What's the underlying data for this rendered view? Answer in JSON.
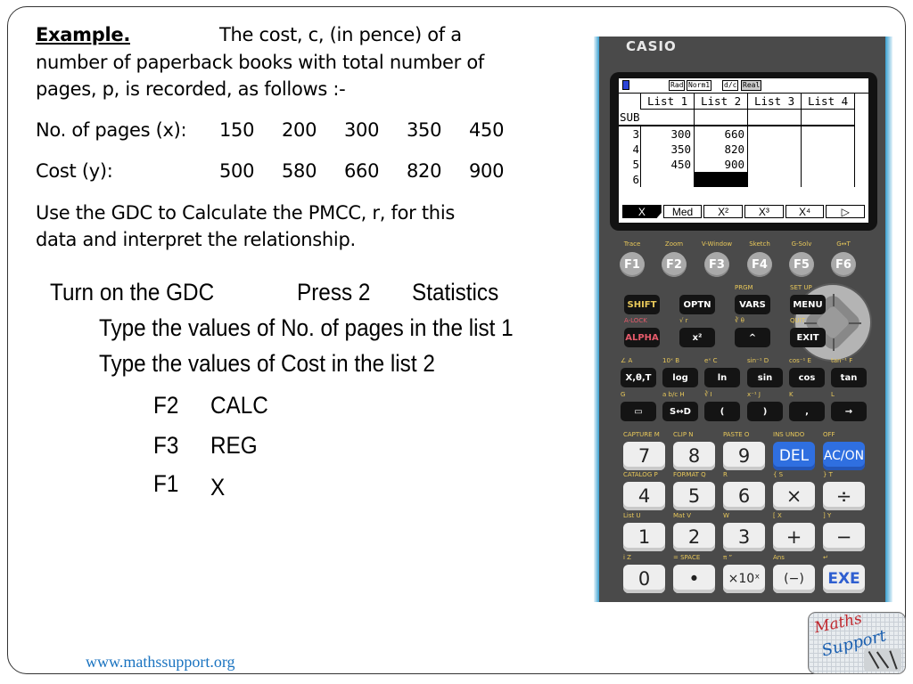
{
  "slide": {
    "title": "Example.",
    "intro_line1": "The cost, c, (in pence) of a",
    "intro_line2": "number of paperback books with total number of",
    "intro_line3": "pages, p, is recorded, as follows :-",
    "x_label": "No. of pages (x):",
    "x_values": [
      "150",
      "200",
      "300",
      "350",
      "450"
    ],
    "y_label": "Cost (y):",
    "y_values": [
      "500",
      "580",
      "660",
      "820",
      "900"
    ],
    "task_line1": "Use the GDC to Calculate the PMCC, r, for this",
    "task_line2": "data and interpret the relationship.",
    "steps": {
      "turn_on": "Turn on the GDC",
      "press": "Press 2",
      "statistics": "Statistics",
      "type_list1": "Type the values of No. of pages in the list 1",
      "type_list2": "Type the values of Cost in the list 2",
      "keys": [
        {
          "key": "F2",
          "action": "CALC"
        },
        {
          "key": "F3",
          "action": "REG"
        },
        {
          "key": "F1",
          "action": "X"
        }
      ]
    },
    "footer_link": "www.mathssupport.org",
    "logo": {
      "line1": "Maths",
      "line2": "Support"
    }
  },
  "calculator": {
    "brand": "CASIO",
    "status_tags": [
      "Rad",
      "Norm1",
      "d/c",
      "Real"
    ],
    "columns": [
      "List 1",
      "List 2",
      "List 3",
      "List 4"
    ],
    "sub_label": "SUB",
    "rows": [
      {
        "index": "3",
        "cells": [
          "300",
          "660",
          "",
          ""
        ]
      },
      {
        "index": "4",
        "cells": [
          "350",
          "820",
          "",
          ""
        ]
      },
      {
        "index": "5",
        "cells": [
          "450",
          "900",
          "",
          ""
        ]
      },
      {
        "index": "6",
        "cells": [
          "",
          "",
          "",
          ""
        ]
      }
    ],
    "function_bar": [
      "X",
      "Med",
      "X²",
      "X³",
      "X⁴",
      "▷"
    ],
    "fkey_labels": [
      "Trace",
      "Zoom",
      "V-Window",
      "Sketch",
      "G-Solv",
      "G↔T"
    ],
    "fkeys": [
      "F1",
      "F2",
      "F3",
      "F4",
      "F5",
      "F6"
    ],
    "row1": {
      "above": [
        "",
        "",
        "PRGM",
        "SET UP"
      ],
      "keys": [
        "SHIFT",
        "OPTN",
        "VARS",
        "MENU"
      ]
    },
    "row2": {
      "above": [
        "A-LOCK",
        "√  r",
        "∛  θ",
        "QUIT"
      ],
      "keys": [
        "ALPHA",
        "x²",
        "^",
        "EXIT"
      ]
    },
    "row3": {
      "above": [
        "∠  A",
        "10ˣ  B",
        "eˣ  C",
        "sin⁻¹  D",
        "cos⁻¹  E",
        "tan⁻¹  F"
      ],
      "keys": [
        "X,θ,T",
        "log",
        "ln",
        "sin",
        "cos",
        "tan"
      ]
    },
    "row4": {
      "above": [
        "G",
        "a b/c  H",
        "∛  I",
        "x⁻¹  J",
        "K",
        "L"
      ],
      "keys": [
        "▭",
        "S↔D",
        "(",
        ")",
        ",",
        "→"
      ]
    },
    "row5": {
      "above": [
        "CAPTURE  M",
        "CLIP  N",
        "PASTE  O",
        "INS  UNDO",
        "OFF"
      ],
      "keys": [
        "7",
        "8",
        "9",
        "DEL",
        "AC/ON"
      ]
    },
    "row6": {
      "above": [
        "CATALOG  P",
        "FORMAT  Q",
        "R",
        "{  S",
        "}  T"
      ],
      "keys": [
        "4",
        "5",
        "6",
        "×",
        "÷"
      ]
    },
    "row7": {
      "above": [
        "List  U",
        "Mat  V",
        "W",
        "[  X",
        "]  Y"
      ],
      "keys": [
        "1",
        "2",
        "3",
        "+",
        "−"
      ]
    },
    "row8": {
      "above": [
        "i  Z",
        "=  SPACE",
        "π  ”",
        "Ans",
        "↵"
      ],
      "keys": [
        "0",
        "•",
        "×10ˣ",
        "(−)",
        "EXE"
      ]
    }
  }
}
